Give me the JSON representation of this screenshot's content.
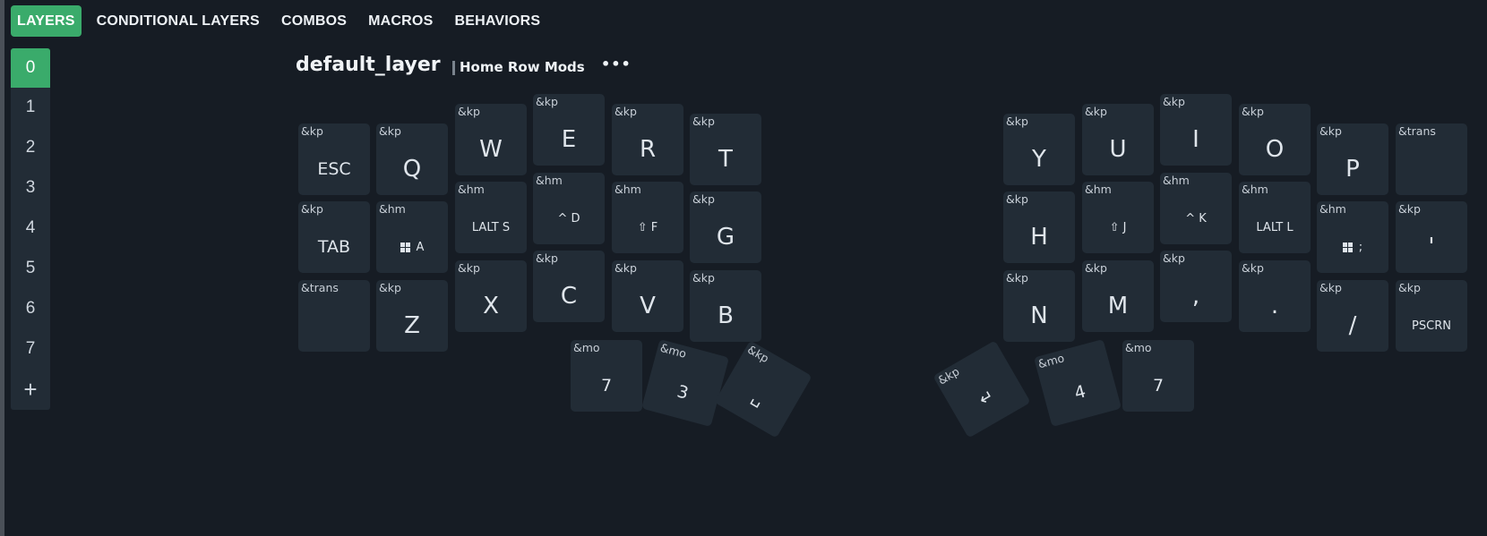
{
  "nav": {
    "tabs": [
      {
        "label": "LAYERS",
        "active": true
      },
      {
        "label": "CONDITIONAL LAYERS"
      },
      {
        "label": "COMBOS"
      },
      {
        "label": "MACROS"
      },
      {
        "label": "BEHAVIORS"
      }
    ]
  },
  "layers": {
    "items": [
      "0",
      "1",
      "2",
      "3",
      "4",
      "5",
      "6",
      "7"
    ],
    "add_label": "+",
    "active_index": 0
  },
  "layer": {
    "title": "default_layer",
    "description": "Home Row Mods",
    "more_label": "•••"
  },
  "keys": [
    {
      "beh": "&kp",
      "label": "ESC",
      "size": "med"
    },
    {
      "beh": "&kp",
      "label": "Q"
    },
    {
      "beh": "&kp",
      "label": "W"
    },
    {
      "beh": "&kp",
      "label": "E"
    },
    {
      "beh": "&kp",
      "label": "R"
    },
    {
      "beh": "&kp",
      "label": "T"
    },
    {
      "beh": "&kp",
      "label": "Y"
    },
    {
      "beh": "&kp",
      "label": "U"
    },
    {
      "beh": "&kp",
      "label": "I"
    },
    {
      "beh": "&kp",
      "label": "O"
    },
    {
      "beh": "&kp",
      "label": "P"
    },
    {
      "beh": "&trans",
      "label": ""
    },
    {
      "beh": "&kp",
      "label": "TAB",
      "size": "med"
    },
    {
      "beh": "&hm",
      "label": "A",
      "size": "sm",
      "icon": "windows-icon"
    },
    {
      "beh": "&hm",
      "label": "LALT S",
      "size": "sm"
    },
    {
      "beh": "&hm",
      "label": "^ D",
      "size": "sm"
    },
    {
      "beh": "&hm",
      "label": "⇧ F",
      "size": "sm"
    },
    {
      "beh": "&kp",
      "label": "G"
    },
    {
      "beh": "&kp",
      "label": "H"
    },
    {
      "beh": "&hm",
      "label": "⇧ J",
      "size": "sm"
    },
    {
      "beh": "&hm",
      "label": "^ K",
      "size": "sm"
    },
    {
      "beh": "&hm",
      "label": "LALT L",
      "size": "sm"
    },
    {
      "beh": "&hm",
      "label": ";",
      "size": "sm",
      "icon": "windows-icon"
    },
    {
      "beh": "&kp",
      "label": "'"
    },
    {
      "beh": "&trans",
      "label": ""
    },
    {
      "beh": "&kp",
      "label": "Z"
    },
    {
      "beh": "&kp",
      "label": "X"
    },
    {
      "beh": "&kp",
      "label": "C"
    },
    {
      "beh": "&kp",
      "label": "V"
    },
    {
      "beh": "&kp",
      "label": "B"
    },
    {
      "beh": "&kp",
      "label": "N"
    },
    {
      "beh": "&kp",
      "label": "M"
    },
    {
      "beh": "&kp",
      "label": ","
    },
    {
      "beh": "&kp",
      "label": "."
    },
    {
      "beh": "&kp",
      "label": "/"
    },
    {
      "beh": "&kp",
      "label": "PSCRN",
      "size": "sm"
    },
    {
      "beh": "&mo",
      "label": "7",
      "size": "med"
    },
    {
      "beh": "&mo",
      "label": "3",
      "size": "med"
    },
    {
      "beh": "&kp",
      "label": "␣",
      "size": "med"
    },
    {
      "beh": "&kp",
      "label": "↵",
      "size": "med"
    },
    {
      "beh": "&mo",
      "label": "4",
      "size": "med"
    },
    {
      "beh": "&mo",
      "label": "7",
      "size": "med"
    }
  ],
  "colors": {
    "background": "#161c24",
    "key": "#222c36",
    "accent": "#3aab6b"
  }
}
